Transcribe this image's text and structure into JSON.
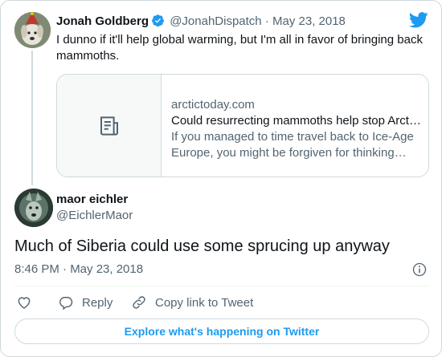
{
  "brand": {
    "accent": "#1d9bf0",
    "logo_icon": "twitter-bird-icon"
  },
  "parent_tweet": {
    "author_name": "Jonah Goldberg",
    "verified_icon": "verified-badge-icon",
    "handle": "@JonahDispatch",
    "separator": "·",
    "date": "May 23, 2018",
    "text": "I dunno if it'll help global warming, but I'm all in favor of bringing back mammoths.",
    "link_card": {
      "thumbnail_icon": "article-icon",
      "domain": "arctictoday.com",
      "title": "Could resurrecting mammoths help stop Arctic warming?",
      "description": "If you managed to time travel back to Ice-Age Europe, you might be forgiven for thinking you'd landed on an alien planet."
    }
  },
  "main_tweet": {
    "author_name": "maor eichler",
    "handle": "@EichlerMaor",
    "text": "Much of Siberia could use some sprucing up anyway",
    "timestamp": "8:46 PM · May 23, 2018",
    "info_icon": "info-icon"
  },
  "actions": {
    "like_icon": "heart-icon",
    "reply_label": "Reply",
    "reply_icon": "reply-icon",
    "copy_label": "Copy link to Tweet",
    "copy_icon": "link-icon"
  },
  "footer": {
    "explore_label": "Explore what's happening on Twitter"
  }
}
